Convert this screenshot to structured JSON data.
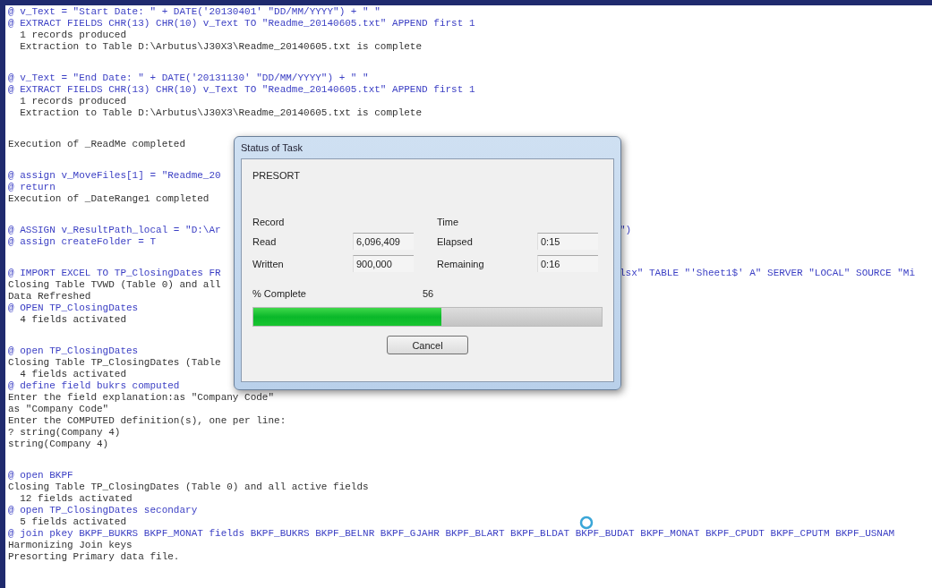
{
  "log": {
    "blocks": [
      {
        "lines": [
          {
            "kind": "command",
            "text": "@ v_Text = \"Start Date: \" + DATE('20130401' \"DD/MM/YYYY\") + \" \""
          },
          {
            "kind": "command",
            "text": "@ EXTRACT FIELDS CHR(13) CHR(10) v_Text TO \"Readme_20140605.txt\" APPEND first 1"
          },
          {
            "kind": "output",
            "text": "  1 records produced"
          },
          {
            "kind": "output",
            "text": "  Extraction to Table D:\\Arbutus\\J30X3\\Readme_20140605.txt is complete"
          }
        ]
      },
      {
        "lines": [
          {
            "kind": "command",
            "text": "@ v_Text = \"End Date: \" + DATE('20131130' \"DD/MM/YYYY\") + \" \""
          },
          {
            "kind": "command",
            "text": "@ EXTRACT FIELDS CHR(13) CHR(10) v_Text TO \"Readme_20140605.txt\" APPEND first 1"
          },
          {
            "kind": "output",
            "text": "  1 records produced"
          },
          {
            "kind": "output",
            "text": "  Extraction to Table D:\\Arbutus\\J30X3\\Readme_20140605.txt is complete"
          }
        ]
      },
      {
        "lines": [
          {
            "kind": "output",
            "text": "Execution of _ReadMe completed"
          }
        ]
      },
      {
        "lines": [
          {
            "kind": "command",
            "text": "@ assign v_MoveFiles[1] = \"Readme_20"
          },
          {
            "kind": "command",
            "text": "@ return"
          },
          {
            "kind": "output",
            "text": "Execution of _DateRange1 completed"
          }
        ]
      },
      {
        "lines": [
          {
            "kind": "command",
            "text": "@ ASSIGN v_ResultPath_local = \"D:\\Ar",
            "tail": "\")"
          },
          {
            "kind": "command",
            "text": "@ assign createFolder = T"
          }
        ]
      },
      {
        "lines": [
          {
            "kind": "command",
            "text": "@ IMPORT EXCEL TO TP_ClosingDates FR",
            "tail": "lsx\" TABLE \"'Sheet1$' A\" SERVER \"LOCAL\" SOURCE \"Mi"
          },
          {
            "kind": "output",
            "text": "Closing Table TVWD (Table 0) and all"
          },
          {
            "kind": "output",
            "text": "Data Refreshed"
          },
          {
            "kind": "command",
            "text": "@ OPEN TP_ClosingDates"
          },
          {
            "kind": "output",
            "text": "  4 fields activated"
          }
        ]
      },
      {
        "lines": [
          {
            "kind": "command",
            "text": "@ open TP_ClosingDates"
          },
          {
            "kind": "output",
            "text": "Closing Table TP_ClosingDates (Table"
          },
          {
            "kind": "output",
            "text": "  4 fields activated"
          },
          {
            "kind": "command",
            "text": "@ define field bukrs computed"
          },
          {
            "kind": "output",
            "text": "Enter the field explanation:as \"Company Code\""
          },
          {
            "kind": "output",
            "text": "as \"Company Code\""
          },
          {
            "kind": "output",
            "text": "Enter the COMPUTED definition(s), one per line:"
          },
          {
            "kind": "output",
            "text": "? string(Company 4)"
          },
          {
            "kind": "output",
            "text": "string(Company 4)"
          }
        ]
      },
      {
        "lines": [
          {
            "kind": "command",
            "text": "@ open BKPF"
          },
          {
            "kind": "output",
            "text": "Closing Table TP_ClosingDates (Table 0) and all active fields"
          },
          {
            "kind": "output",
            "text": "  12 fields activated"
          },
          {
            "kind": "command",
            "text": "@ open TP_ClosingDates secondary"
          },
          {
            "kind": "output",
            "text": "  5 fields activated"
          },
          {
            "kind": "command",
            "text": "@ join pkey BKPF_BUKRS BKPF_MONAT fields BKPF_BUKRS BKPF_BELNR BKPF_GJAHR BKPF_BLART BKPF_BLDAT BKPF_BUDAT BKPF_MONAT BKPF_CPUDT BKPF_CPUTM BKPF_USNAM"
          },
          {
            "kind": "output",
            "text": "Harmonizing Join keys"
          },
          {
            "kind": "output",
            "text": "Presorting Primary data file."
          }
        ]
      }
    ]
  },
  "dialog": {
    "title": "Status of Task",
    "task": "PRESORT",
    "groups": [
      {
        "heading": "Record",
        "rows": [
          {
            "label": "Read",
            "value": "6,096,409"
          },
          {
            "label": "Written",
            "value": "900,000"
          }
        ]
      },
      {
        "heading": "Time",
        "rows": [
          {
            "label": "Elapsed",
            "value": "0:15"
          },
          {
            "label": "Remaining",
            "value": "0:16"
          }
        ]
      }
    ],
    "complete_label": "% Complete",
    "complete_value": "56",
    "progress": {
      "level": 0.54
    },
    "cancel": "Cancel"
  }
}
